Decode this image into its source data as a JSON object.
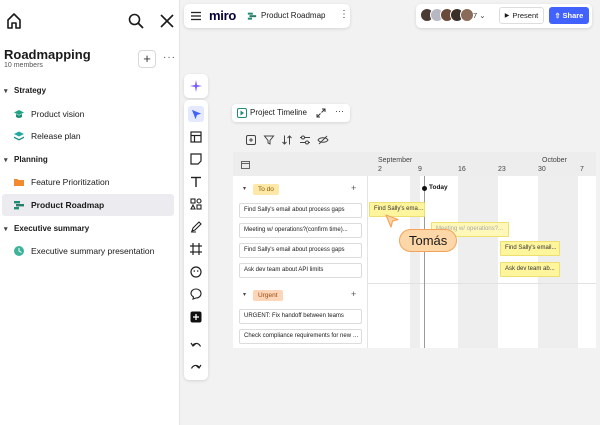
{
  "sidebar": {
    "title": "Roadmapping",
    "members": "10 members",
    "add_label": "+",
    "more_label": "···",
    "sections": [
      {
        "label": "Strategy",
        "items": [
          {
            "label": "Product vision",
            "icon": "graduation-cap-icon"
          },
          {
            "label": "Release plan",
            "icon": "stack-icon"
          }
        ]
      },
      {
        "label": "Planning",
        "items": [
          {
            "label": "Feature Prioritization",
            "icon": "folder-icon"
          },
          {
            "label": "Product Roadmap",
            "icon": "board-icon",
            "active": true
          }
        ]
      },
      {
        "label": "Executive summary",
        "items": [
          {
            "label": "Executive summary presentation",
            "icon": "presentation-icon"
          }
        ]
      }
    ]
  },
  "topbar": {
    "logo": "miro",
    "board_name": "Product Roadmap",
    "more": "⋮"
  },
  "collab": {
    "avatar_count": "7",
    "present_label": "Present",
    "share_label": "Share",
    "avatar_colors": [
      "#4a3b35",
      "#b8b8c2",
      "#6a4a3a",
      "#3b2f2a",
      "#8a6a58"
    ]
  },
  "timeline": {
    "title": "Project Timeline",
    "more": "···",
    "months": [
      "September",
      "October"
    ],
    "days": [
      "2",
      "9",
      "16",
      "23",
      "30",
      "7"
    ],
    "today_label": "Today",
    "groups": [
      {
        "label": "To do",
        "color": "#fde8a8",
        "text_color": "#8a5a00",
        "rows": [
          "Find Sally's email about process gaps",
          "Meeting w/ operations?(confirm time)...",
          "Find Sally's email about process gaps",
          "Ask dev team about API limits"
        ]
      },
      {
        "label": "Urgent",
        "color": "#fdd5b8",
        "text_color": "#9a4a10",
        "rows": [
          "URGENT: Fix handoff between teams",
          "Check compliance requirements for new p..."
        ]
      }
    ],
    "bars": [
      {
        "label": "Find Sally's email about...",
        "faded": false
      },
      {
        "label": "Meeting w/ operations?...",
        "faded": true
      },
      {
        "label": "Find Sally's email...",
        "faded": false
      },
      {
        "label": "Ask dev team ab...",
        "faded": false
      }
    ]
  },
  "cursor": {
    "name": "Tomás",
    "color": "#fdd7a7"
  }
}
